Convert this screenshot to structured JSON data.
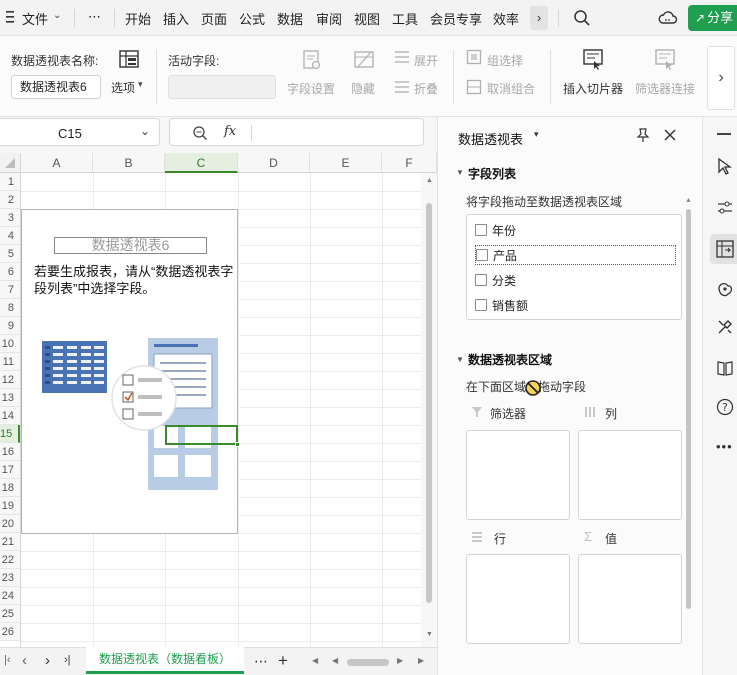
{
  "menubar": {
    "app_menu": "文件",
    "more": "⋯",
    "tabs": [
      "开始",
      "插入",
      "页面",
      "公式",
      "数据",
      "审阅",
      "视图",
      "工具",
      "会员专享",
      "效率"
    ],
    "share_label": "分享"
  },
  "ribbon": {
    "pivot_name_label": "数据透视表名称:",
    "pivot_name_value": "数据透视表6",
    "options_label": "选项",
    "active_field_label": "活动字段:",
    "field_settings": "字段设置",
    "hide": "隐藏",
    "expand": "展开",
    "collapse": "折叠",
    "group_selection": "组选择",
    "ungroup": "取消组合",
    "insert_slicer": "插入切片器",
    "filter_connections": "筛选器连接"
  },
  "formula_bar": {
    "cell_ref": "C15",
    "fx": "fx",
    "formula": ""
  },
  "grid": {
    "columns": [
      "A",
      "B",
      "C",
      "D",
      "E",
      "F"
    ],
    "rows": [
      "1",
      "2",
      "3",
      "4",
      "5",
      "6",
      "7",
      "8",
      "9",
      "10",
      "11",
      "12",
      "13",
      "14",
      "15",
      "16",
      "17",
      "18",
      "19",
      "20",
      "21",
      "22",
      "23",
      "24",
      "25",
      "26"
    ],
    "selected_column": "C",
    "selected_row": "15"
  },
  "placeholder": {
    "title": "数据透视表6",
    "instruction": "若要生成报表，请从“数据透视表字段列表”中选择字段。"
  },
  "sheet_tabs": {
    "active_sheet": "数据透视表（数据看板）",
    "more": "⋯",
    "add": "+"
  },
  "panel": {
    "title": "数据透视表",
    "field_list_heading": "字段列表",
    "drag_hint": "将字段拖动至数据透视表区域",
    "fields": [
      "年份",
      "产品",
      "分类",
      "销售额"
    ],
    "area_heading": "数据透视表区域",
    "area_hint": "在下面区域中拖动字段",
    "areas": {
      "filter": "筛选器",
      "columns": "列",
      "rows": "行",
      "values": "值"
    }
  },
  "colors": {
    "accent_green": "#1e9e4e",
    "selection_green": "#3a8a2c",
    "pivot_blue": "#4a73b5"
  }
}
